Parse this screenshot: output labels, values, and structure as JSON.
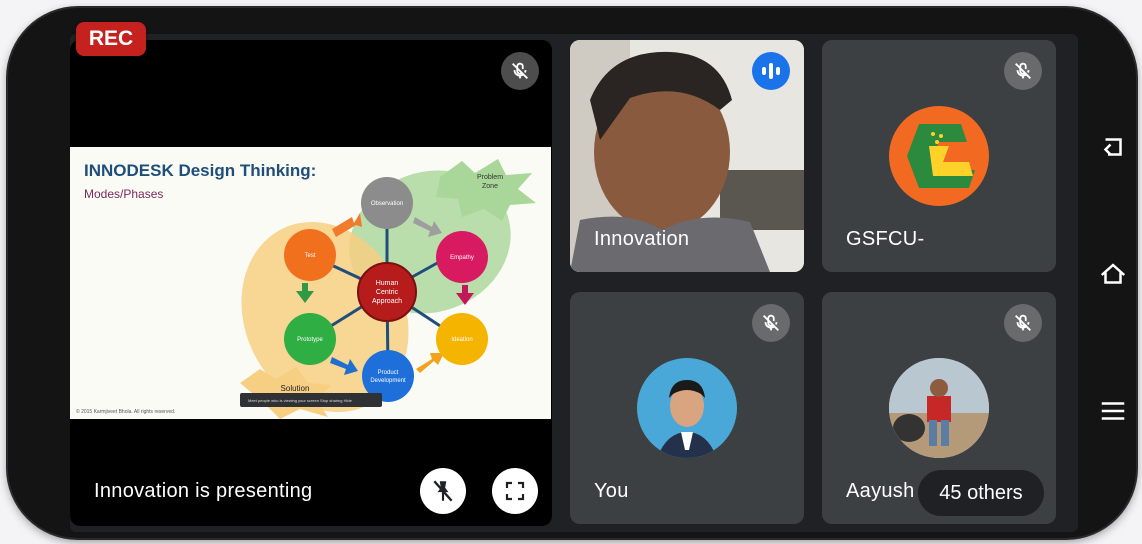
{
  "recording": {
    "label": "REC"
  },
  "presentation": {
    "status": "Innovation is presenting",
    "slide": {
      "title": "INNODESK Design Thinking:",
      "subtitle": "Modes/Phases",
      "center": [
        "Human",
        "Centric",
        "Approach"
      ],
      "nodes": {
        "observation": "Observation",
        "empathy": "Empathy",
        "ideation": "Ideation",
        "product": [
          "Product",
          "Development"
        ],
        "prototype": "Prototype",
        "test": "Test"
      },
      "problem_zone": [
        "Problem",
        "Zone"
      ],
      "solution": "Solution",
      "copyright": "© 2015 Karmjiveet Bhola. All rights reserved.",
      "toast": "Meet people who is viewing your screen   Stop sharing   Hide"
    }
  },
  "participants": [
    {
      "name": "Innovation",
      "speaking": true
    },
    {
      "name": "GSFCU-",
      "muted": true
    },
    {
      "name": "You",
      "muted": true
    },
    {
      "name": "Aayush",
      "muted": true
    }
  ],
  "others": {
    "label": "45 others"
  },
  "colors": {
    "rec": "#c5221f",
    "tile": "#3c4043",
    "speaking": "#1a73e8",
    "background": "#202124"
  },
  "icons": [
    "mic-off-icon",
    "pin-off-icon",
    "fullscreen-icon",
    "speaking-indicator-icon",
    "back-icon",
    "home-icon",
    "menu-icon"
  ]
}
